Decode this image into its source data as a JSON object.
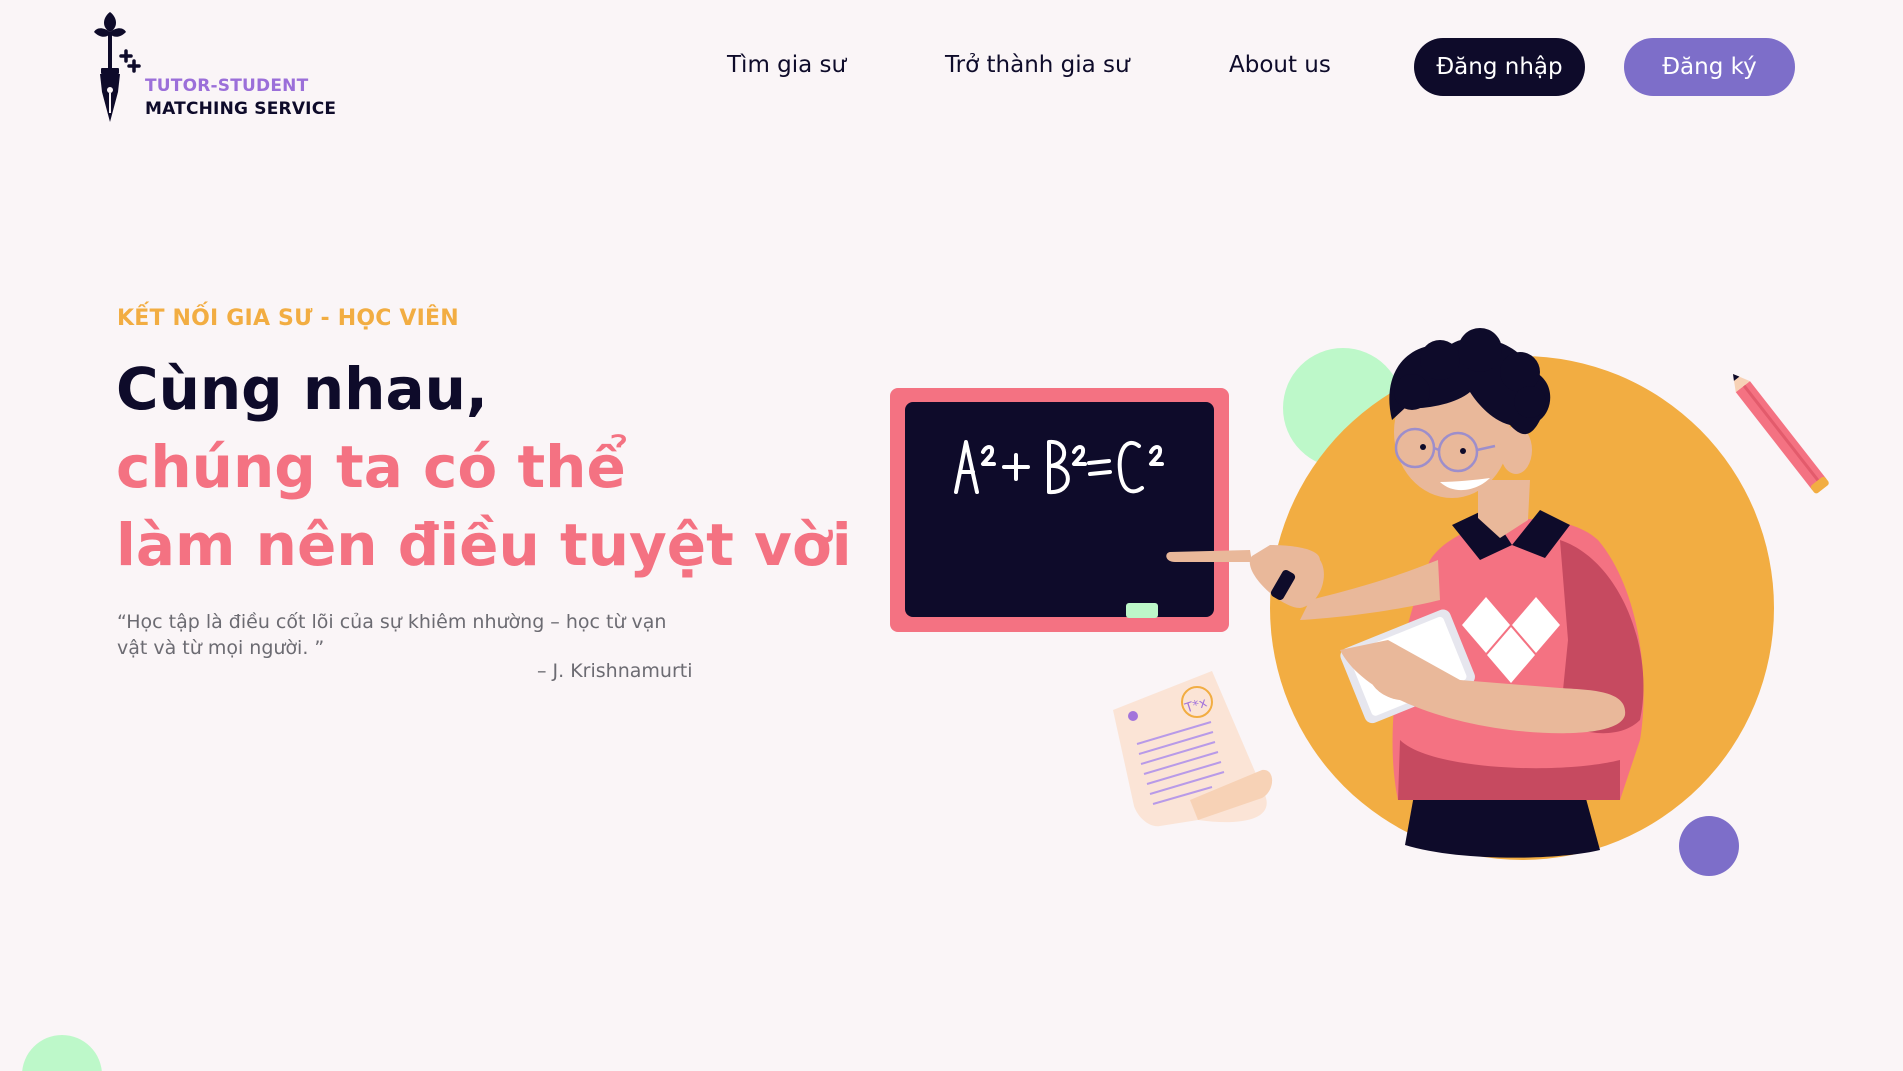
{
  "brand": {
    "line1": "TUTOR-STUDENT",
    "line2": "MATCHING SERVICE"
  },
  "nav": {
    "find_tutor": "Tìm gia sư",
    "become_tutor": "Trở thành gia sư",
    "about": "About us",
    "login": "Đăng nhập",
    "signup": "Đăng ký"
  },
  "hero": {
    "eyebrow": "KẾT NỐI GIA SƯ - HỌC VIÊN",
    "headline_line1": "Cùng nhau,",
    "headline_line2": "chúng ta có thể",
    "headline_line3": "làm nên điều tuyệt vời",
    "quote": "“Học tập là điều cốt lõi của sự khiêm nhường – học từ vạn vật và từ mọi người. ”",
    "quote_author": "– J. Krishnamurti"
  },
  "illustration": {
    "blackboard_formula": "A²+B²=C²"
  },
  "colors": {
    "background": "#faf5f7",
    "navy": "#0e0b2a",
    "brand_purple": "#7d6ec9",
    "logo_purple": "#9b6fd9",
    "accent_orange": "#f2ad42",
    "accent_pink": "#f47282",
    "mint": "#bdf8c9"
  }
}
